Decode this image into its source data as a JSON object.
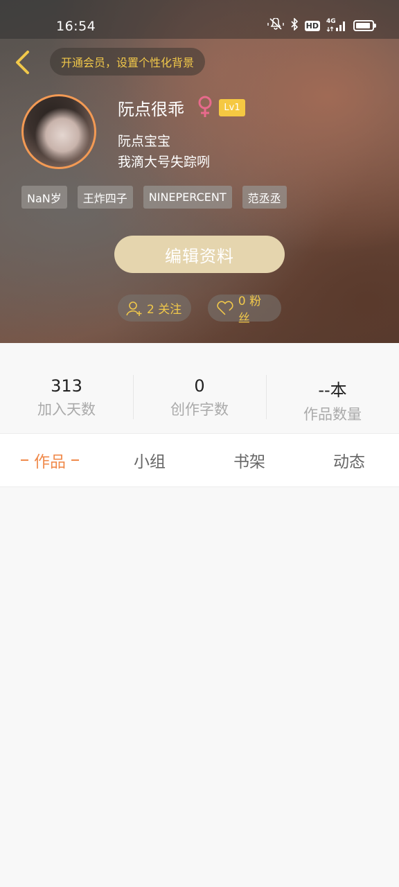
{
  "status_bar": {
    "time": "16:54",
    "network": "4G",
    "hd": "HD",
    "battery_level": 0.85,
    "icons": [
      "mute-vibrate-icon",
      "bluetooth-icon",
      "hd-icon",
      "signal-icon",
      "battery-icon"
    ]
  },
  "header": {
    "vip_prompt": "开通会员，设置个性化背景",
    "accent_color": "#f1c84a"
  },
  "profile": {
    "username": "阮点很乖",
    "gender": "female",
    "level": "Lv1",
    "nickname": "阮点宝宝",
    "bio": "我滴大号失踪咧",
    "tags": [
      "NaN岁",
      "王炸四子",
      "NINEPERCENT",
      "范丞丞"
    ],
    "edit_label": "编辑资料",
    "following": "2 关注",
    "fans": "0 粉丝"
  },
  "stats": [
    {
      "value": "313",
      "label": "加入天数"
    },
    {
      "value": "0",
      "label": "创作字数"
    },
    {
      "value": "--本",
      "label": "作品数量"
    }
  ],
  "tabs": [
    {
      "label": "作品",
      "active": true
    },
    {
      "label": "小组",
      "active": false
    },
    {
      "label": "书架",
      "active": false
    },
    {
      "label": "动态",
      "active": false
    }
  ],
  "colors": {
    "tab_active": "#f08a4b",
    "avatar_ring": "#f39a54",
    "edit_button": "#e5d5ae",
    "level_badge": "#f5c842",
    "gender": "#e86a8c"
  }
}
